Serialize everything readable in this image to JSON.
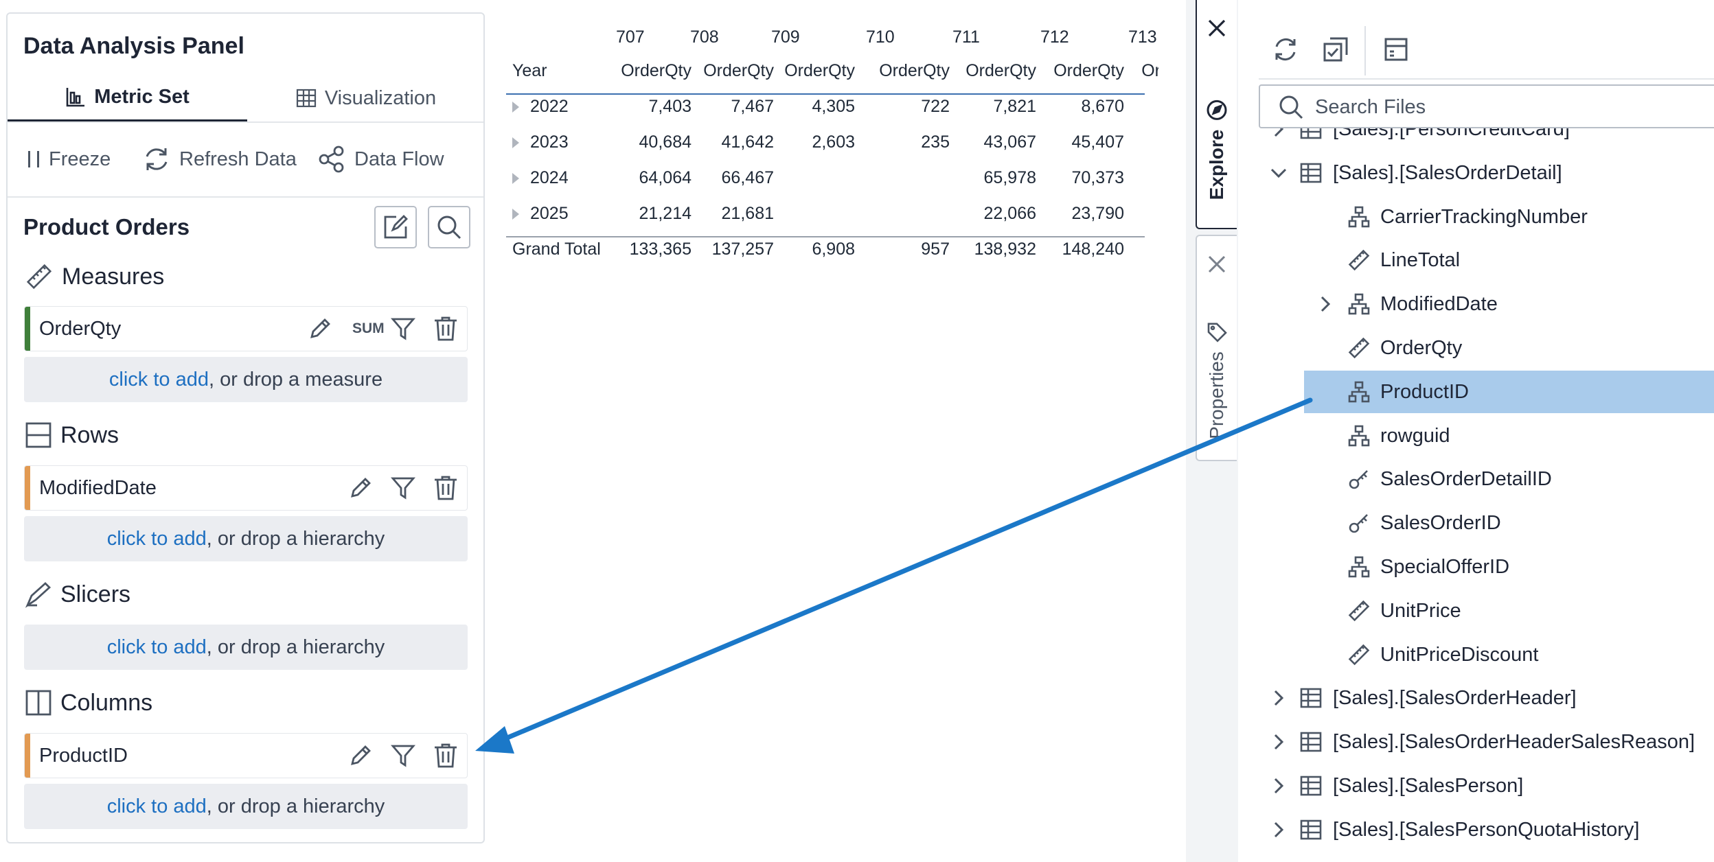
{
  "panel": {
    "title": "Data Analysis Panel",
    "tabs": {
      "metric": "Metric Set",
      "visualization": "Visualization"
    },
    "toolbar": {
      "freeze": "Freeze",
      "refresh": "Refresh Data",
      "dataflow": "Data Flow"
    },
    "section_title": "Product Orders",
    "measures": {
      "heading": "Measures",
      "field": {
        "name": "OrderQty",
        "aggregate": "SUM",
        "accent": "#3f7f3a"
      },
      "drop": {
        "link": "click to add",
        "rest": ", or drop a measure"
      }
    },
    "rows": {
      "heading": "Rows",
      "field": {
        "name": "ModifiedDate",
        "accent": "#e29a52"
      },
      "drop": {
        "link": "click to add",
        "rest": ", or drop a hierarchy"
      }
    },
    "slicers": {
      "heading": "Slicers",
      "drop": {
        "link": "click to add",
        "rest": ", or drop a hierarchy"
      }
    },
    "columns": {
      "heading": "Columns",
      "field": {
        "name": "ProductID",
        "accent": "#e29a52"
      },
      "drop": {
        "link": "click to add",
        "rest": ", or drop a hierarchy"
      }
    }
  },
  "pivot": {
    "row_header": "Year",
    "product_ids": [
      "707",
      "708",
      "709",
      "710",
      "711",
      "712",
      "713"
    ],
    "measure_label": "OrderQty",
    "rows": [
      {
        "label": "2022",
        "values": [
          "7,403",
          "7,467",
          "4,305",
          "722",
          "7,821",
          "8,670",
          ""
        ]
      },
      {
        "label": "2023",
        "values": [
          "40,684",
          "41,642",
          "2,603",
          "235",
          "43,067",
          "45,407",
          ""
        ]
      },
      {
        "label": "2024",
        "values": [
          "64,064",
          "66,467",
          "",
          "",
          "65,978",
          "70,373",
          ""
        ]
      },
      {
        "label": "2025",
        "values": [
          "21,214",
          "21,681",
          "",
          "",
          "22,066",
          "23,790",
          ""
        ]
      }
    ],
    "total": {
      "label": "Grand Total",
      "values": [
        "133,365",
        "137,257",
        "6,908",
        "957",
        "138,932",
        "148,240",
        ""
      ]
    }
  },
  "side_tabs": {
    "explore": "Explore",
    "properties": "Properties"
  },
  "explorer": {
    "search_placeholder": "Search Files",
    "tree": [
      {
        "label": "[Sales].[PersonCreditCard]",
        "icon": "table-icon",
        "chevron": "right",
        "level": 0
      },
      {
        "label": "[Sales].[SalesOrderDetail]",
        "icon": "table-icon",
        "chevron": "down",
        "level": 0
      },
      {
        "label": "CarrierTrackingNumber",
        "icon": "hierarchy-icon",
        "chevron": "",
        "level": 1
      },
      {
        "label": "LineTotal",
        "icon": "ruler-icon",
        "chevron": "",
        "level": 1
      },
      {
        "label": "ModifiedDate",
        "icon": "hierarchy-icon",
        "chevron": "right",
        "level": 1
      },
      {
        "label": "OrderQty",
        "icon": "ruler-icon",
        "chevron": "",
        "level": 1
      },
      {
        "label": "ProductID",
        "icon": "hierarchy-icon",
        "chevron": "",
        "level": 1,
        "selected": true
      },
      {
        "label": "rowguid",
        "icon": "hierarchy-icon",
        "chevron": "",
        "level": 1
      },
      {
        "label": "SalesOrderDetailID",
        "icon": "key-icon",
        "chevron": "",
        "level": 1
      },
      {
        "label": "SalesOrderID",
        "icon": "key-icon",
        "chevron": "",
        "level": 1
      },
      {
        "label": "SpecialOfferID",
        "icon": "hierarchy-icon",
        "chevron": "",
        "level": 1
      },
      {
        "label": "UnitPrice",
        "icon": "ruler-icon",
        "chevron": "",
        "level": 1
      },
      {
        "label": "UnitPriceDiscount",
        "icon": "ruler-icon",
        "chevron": "",
        "level": 1
      },
      {
        "label": "[Sales].[SalesOrderHeader]",
        "icon": "table-icon",
        "chevron": "right",
        "level": 0
      },
      {
        "label": "[Sales].[SalesOrderHeaderSalesReason]",
        "icon": "table-icon",
        "chevron": "right",
        "level": 0
      },
      {
        "label": "[Sales].[SalesPerson]",
        "icon": "table-icon",
        "chevron": "right",
        "level": 0
      },
      {
        "label": "[Sales].[SalesPersonQuotaHistory]",
        "icon": "table-icon",
        "chevron": "right",
        "level": 0
      }
    ]
  },
  "colors": {
    "accent_blue": "#1b78c8",
    "link": "#1d6fc1",
    "selected_row": "#a9cbeb"
  }
}
